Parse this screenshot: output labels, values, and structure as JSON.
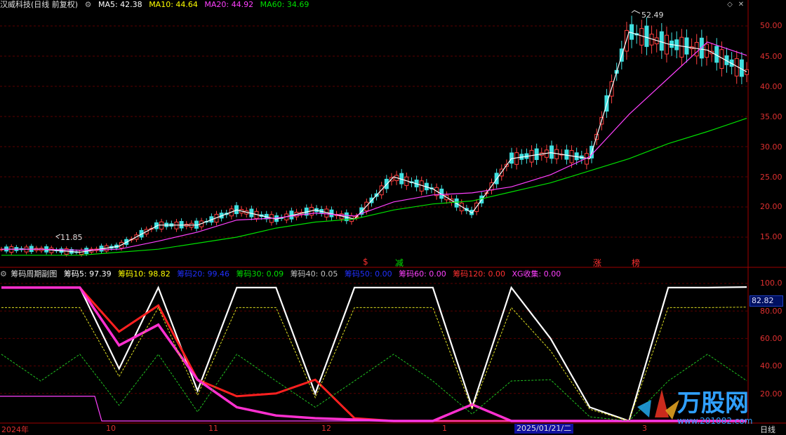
{
  "window": {
    "title": "汉威科技(日线 前复权)",
    "indicators": [
      {
        "label": "MA5: 42.38",
        "color": "#ffffff"
      },
      {
        "label": "MA10: 44.64",
        "color": "#ffff00"
      },
      {
        "label": "MA20: 44.92",
        "color": "#ff40ff"
      },
      {
        "label": "MA60: 34.69",
        "color": "#00e000"
      }
    ],
    "high_label": "52.49",
    "low_label": "11.85",
    "price_axis": [
      "50.00",
      "45.00",
      "40.00",
      "35.00",
      "30.00",
      "25.00",
      "20.00",
      "15.00"
    ],
    "markers": [
      {
        "text": "$",
        "color": "#ff3030"
      },
      {
        "text": "减",
        "color": "#00e000"
      },
      {
        "text": "涨",
        "color": "#ff3030"
      },
      {
        "text": "榜",
        "color": "#ff3030"
      }
    ]
  },
  "sub": {
    "title": "筹码周期副图",
    "indicators": [
      {
        "label": "筹码5: 97.39",
        "color": "#ffffff"
      },
      {
        "label": "筹码10: 98.82",
        "color": "#ffff00"
      },
      {
        "label": "筹码20: 99.46",
        "color": "#2030ff"
      },
      {
        "label": "筹码30: 0.09",
        "color": "#00e000"
      },
      {
        "label": "筹码40: 0.05",
        "color": "#c0c0c0"
      },
      {
        "label": "筹码50: 0.00",
        "color": "#2030ff"
      },
      {
        "label": "筹码60: 0.00",
        "color": "#ff40ff"
      },
      {
        "label": "筹码120: 0.00",
        "color": "#ff3030"
      },
      {
        "label": "XG收集: 0.00",
        "color": "#ff40ff"
      }
    ],
    "axis": [
      "100.0",
      "80.00",
      "60.00",
      "40.00",
      "20.00"
    ],
    "current_value": "82.82"
  },
  "x_axis": {
    "dates": [
      "2024年",
      "10",
      "11",
      "12",
      "1",
      "2",
      "3"
    ],
    "cursor_date": "2025/01/21/二",
    "period": "日线"
  },
  "chart_data": [
    {
      "type": "line",
      "title": "汉威科技(日线 前复权)",
      "series": [
        {
          "name": "MA5",
          "values": [
            13,
            13,
            12.5,
            13.5,
            17,
            17,
            19.5,
            18,
            19.5,
            18,
            25,
            23,
            19,
            28,
            29,
            28,
            49,
            47,
            46,
            42.4
          ]
        },
        {
          "name": "MA60",
          "values": [
            12,
            12,
            12,
            12.5,
            13,
            14,
            15,
            16.5,
            17.5,
            18,
            19.5,
            20.5,
            21,
            22.5,
            24,
            26,
            28,
            30.5,
            32.5,
            34.7
          ]
        }
      ],
      "high": 52.49,
      "low": 11.85,
      "ylim": [
        11,
        53
      ]
    },
    {
      "type": "line",
      "title": "筹码周期副图",
      "series": [
        {
          "name": "筹码5",
          "values": [
            97,
            97,
            97,
            38,
            97,
            22,
            97,
            97,
            20,
            97,
            97,
            97,
            10,
            97,
            60,
            10,
            0,
            97,
            97,
            97.4
          ]
        },
        {
          "name": "筹码120",
          "values": [
            97,
            97,
            97,
            65,
            84,
            30,
            18,
            20,
            30,
            2,
            0,
            0,
            0,
            0,
            0,
            0,
            0,
            0,
            0,
            0
          ]
        },
        {
          "name": "筹码60",
          "values": [
            97,
            97,
            97,
            55,
            70,
            30,
            10,
            4,
            2,
            1,
            0,
            0,
            12,
            0,
            0,
            0,
            0,
            0,
            0,
            0
          ]
        }
      ],
      "ylim": [
        0,
        100
      ]
    }
  ]
}
